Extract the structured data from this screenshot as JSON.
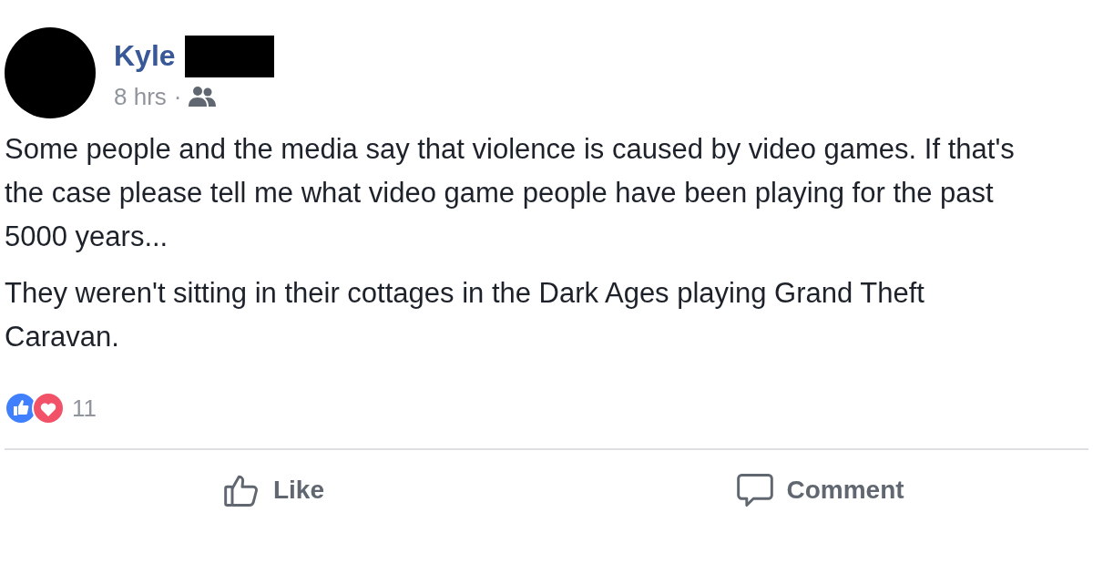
{
  "post": {
    "author": "Kyle",
    "time": "8 hrs",
    "separator": "·",
    "paragraphs": [
      "Some people and the media say that violence is caused by video games. If that's the case please tell me what video game people have been playing for the past 5000 years...",
      "They weren't sitting in their cottages in the Dark Ages playing Grand Theft Caravan."
    ],
    "reaction_count": "11",
    "actions": [
      {
        "kind": "like",
        "label": "Like"
      },
      {
        "kind": "comment",
        "label": "Comment"
      }
    ]
  }
}
